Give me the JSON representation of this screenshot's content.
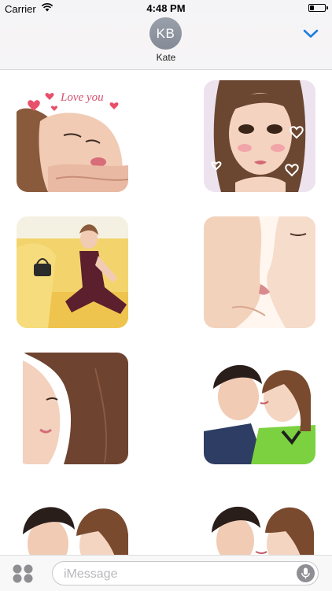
{
  "status_bar": {
    "carrier": "Carrier",
    "time": "4:48 PM"
  },
  "header": {
    "avatar_initials": "KB",
    "contact_name": "Kate"
  },
  "stickers": [
    {
      "id": "sticker-1",
      "caption": "Love you"
    },
    {
      "id": "sticker-2"
    },
    {
      "id": "sticker-3"
    },
    {
      "id": "sticker-4"
    },
    {
      "id": "sticker-5"
    },
    {
      "id": "sticker-6"
    },
    {
      "id": "sticker-7"
    },
    {
      "id": "sticker-8"
    }
  ],
  "input_bar": {
    "placeholder": "iMessage"
  },
  "colors": {
    "accent": "#1e7de0",
    "avatar": "#8b919c",
    "heart": "#e8506a"
  },
  "icons": [
    "wifi-icon",
    "battery-icon",
    "chevron-down-icon",
    "app-drawer-icon",
    "microphone-icon"
  ]
}
